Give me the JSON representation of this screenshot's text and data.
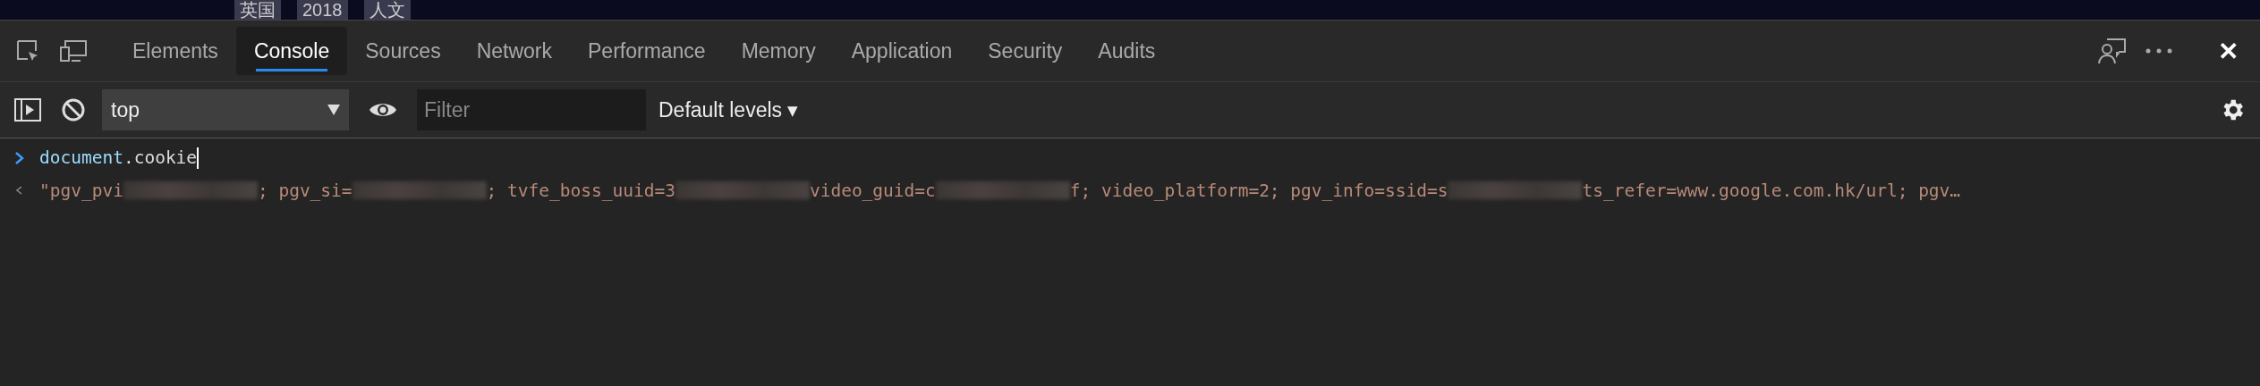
{
  "page_strip": {
    "tags": [
      "英国",
      "2018",
      "人文"
    ]
  },
  "tabs": [
    {
      "label": "Elements",
      "selected": false
    },
    {
      "label": "Console",
      "selected": true
    },
    {
      "label": "Sources",
      "selected": false
    },
    {
      "label": "Network",
      "selected": false
    },
    {
      "label": "Performance",
      "selected": false
    },
    {
      "label": "Memory",
      "selected": false
    },
    {
      "label": "Application",
      "selected": false
    },
    {
      "label": "Security",
      "selected": false
    },
    {
      "label": "Audits",
      "selected": false
    }
  ],
  "close_glyph": "✕",
  "toolbar": {
    "context": "top",
    "filter": {
      "placeholder": "Filter"
    },
    "levels": "Default levels ▾"
  },
  "console": {
    "input": {
      "object": "document",
      "property": ".cookie"
    },
    "output": [
      {
        "kind": "text",
        "text": "\"pgv_pvi"
      },
      {
        "kind": "redacted"
      },
      {
        "kind": "text",
        "text": "; pgv_si="
      },
      {
        "kind": "redacted"
      },
      {
        "kind": "text",
        "text": "; tvfe_boss_uuid=3"
      },
      {
        "kind": "redacted"
      },
      {
        "kind": "text",
        "text": " video_guid=c"
      },
      {
        "kind": "redacted"
      },
      {
        "kind": "text",
        "text": "f; video_platform=2; pgv_info=ssid=s"
      },
      {
        "kind": "redacted"
      },
      {
        "kind": "text",
        "text": " ts_refer=www.google.com.hk/url; pgv…"
      }
    ]
  }
}
